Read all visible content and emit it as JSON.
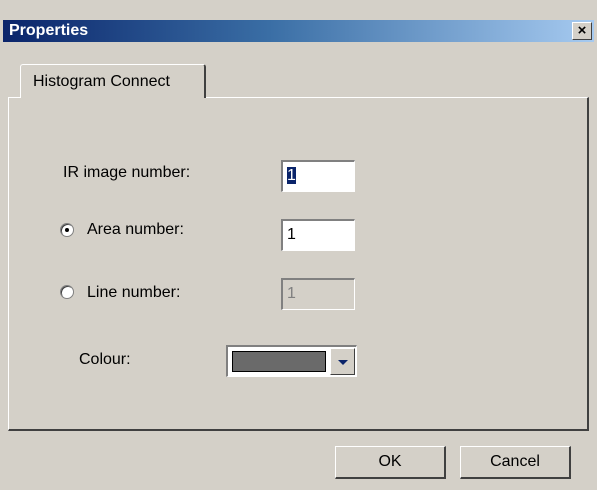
{
  "window": {
    "title": "Properties",
    "close_glyph": "×"
  },
  "tabs": [
    {
      "label": "Histogram Connect",
      "active": true
    }
  ],
  "form": {
    "ir_image_label": "IR image number:",
    "ir_image_value": "1",
    "area_label": "Area number:",
    "area_value": "1",
    "area_selected": true,
    "line_label": "Line number:",
    "line_value": "1",
    "line_selected": false,
    "colour_label": "Colour:",
    "colour_value": "#6a6a6a"
  },
  "buttons": {
    "ok_label": "OK",
    "cancel_label": "Cancel"
  },
  "colors": {
    "title_bar_start": "#0a246a",
    "title_bar_end": "#a6caf0",
    "dialog_face": "#d4d0c8"
  }
}
